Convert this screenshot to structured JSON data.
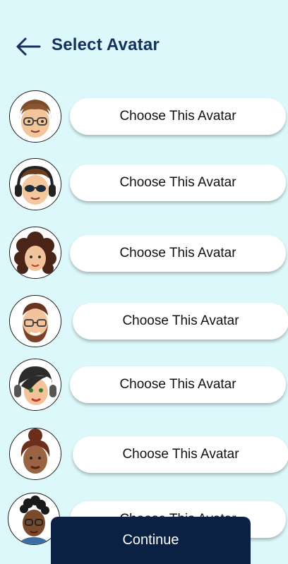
{
  "header": {
    "title": "Select Avatar",
    "back_icon": "arrow-left-icon"
  },
  "avatars": [
    {
      "label": "Choose This Avatar",
      "icon": "avatar-glasses-man-icon"
    },
    {
      "label": "Choose This Avatar",
      "icon": "avatar-headphones-sunglasses-icon"
    },
    {
      "label": "Choose This Avatar",
      "icon": "avatar-curly-hair-woman-icon"
    },
    {
      "label": "Choose This Avatar",
      "icon": "avatar-beard-glasses-man-icon"
    },
    {
      "label": "Choose This Avatar",
      "icon": "avatar-headphones-woman-icon"
    },
    {
      "label": "Choose This Avatar",
      "icon": "avatar-bun-hair-woman-icon"
    },
    {
      "label": "Choose This Avatar",
      "icon": "avatar-glasses-woman-icon"
    }
  ],
  "footer": {
    "continue_label": "Continue"
  },
  "colors": {
    "background": "#dcf8fb",
    "title": "#13315c",
    "primary_button": "#0b2144"
  }
}
